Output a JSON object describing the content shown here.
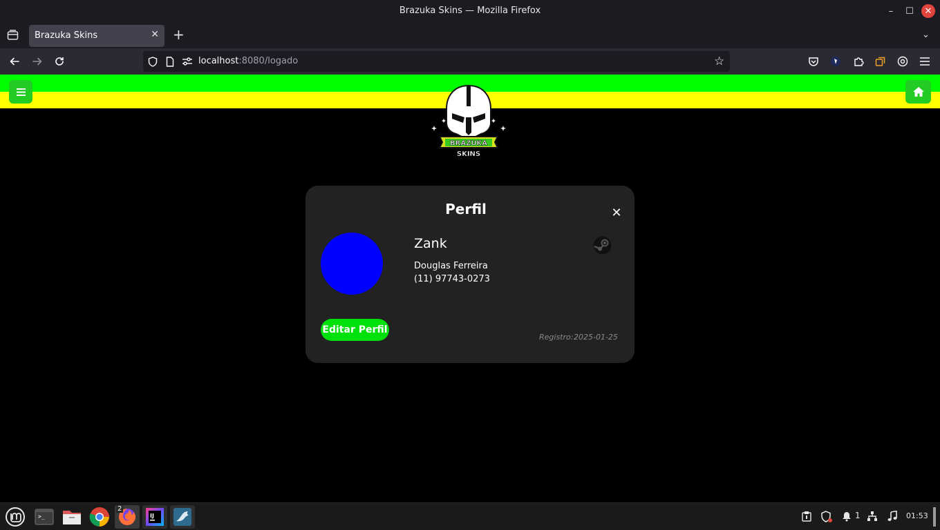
{
  "window": {
    "title": "Brazuka Skins — Mozilla Firefox",
    "minimize_glyph": "–",
    "maximize_glyph": "☐",
    "close_glyph": "✕"
  },
  "tabs": {
    "active_title": "Brazuka Skins",
    "close_glyph": "✕",
    "new_tab_glyph": "+",
    "overflow_glyph": "⌄"
  },
  "navigation": {
    "url_host": "localhost",
    "url_rest": ":8080/logado"
  },
  "page": {
    "colors": {
      "top_stripe": "#00ff00",
      "bottom_stripe": "#ffff00",
      "nav_button": "#22cc22",
      "card_background": "#222222",
      "avatar": "#0000ff",
      "edit_button": "#00e00b"
    },
    "logo": {
      "text_top": "BRAZUKA",
      "text_bottom": "SKINS"
    }
  },
  "profile": {
    "title": "Perfil",
    "close_glyph": "✕",
    "username": "Zank",
    "full_name": "Douglas Ferreira",
    "phone": "(11) 97743-0273",
    "edit_button_label": "Editar Perfil",
    "registration_label": "Registro:",
    "registration_date": "2025-01-25"
  },
  "taskbar": {
    "firefox_window_count": "2",
    "notifications_count": "1",
    "clock": "01:53",
    "idea_badge": "IJ"
  }
}
